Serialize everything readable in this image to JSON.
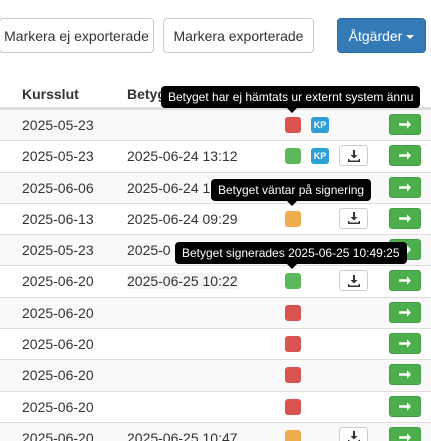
{
  "toolbar": {
    "mark_not_exported_label": "Markera ej exporterade",
    "mark_exported_label": "Markera exporterade",
    "actions_label": "Åtgärder"
  },
  "table": {
    "headers": {
      "course_end": "Kursslut",
      "grade": "Betyg"
    },
    "rows": [
      {
        "course_end": "2025-05-23",
        "grade_date": "",
        "status": "red",
        "kp": true,
        "download": false
      },
      {
        "course_end": "2025-05-23",
        "grade_date": "2025-06-24 13:12",
        "status": "green",
        "kp": true,
        "download": true
      },
      {
        "course_end": "2025-06-06",
        "grade_date": "2025-06-24 1",
        "status": "green",
        "kp": false,
        "download": false
      },
      {
        "course_end": "2025-06-13",
        "grade_date": "2025-06-24 09:29",
        "status": "orange",
        "kp": false,
        "download": true
      },
      {
        "course_end": "2025-05-23",
        "grade_date": "2025-0",
        "status": "green",
        "kp": false,
        "download": false
      },
      {
        "course_end": "2025-06-20",
        "grade_date": "2025-06-25 10:22",
        "status": "green",
        "kp": false,
        "download": true
      },
      {
        "course_end": "2025-06-20",
        "grade_date": "",
        "status": "red",
        "kp": false,
        "download": false
      },
      {
        "course_end": "2025-06-20",
        "grade_date": "",
        "status": "red",
        "kp": false,
        "download": false
      },
      {
        "course_end": "2025-06-20",
        "grade_date": "",
        "status": "red",
        "kp": false,
        "download": false
      },
      {
        "course_end": "2025-06-20",
        "grade_date": "",
        "status": "red",
        "kp": false,
        "download": false
      },
      {
        "course_end": "2025-06-20",
        "grade_date": "2025-06-25 10:47",
        "status": "orange",
        "kp": false,
        "download": true
      }
    ]
  },
  "kp_label": "KP",
  "tooltips": {
    "not_fetched": "Betyget har ej hämtats ur externt system ännu",
    "awaiting_signing": "Betyget väntar på signering",
    "signed": "Betyget signerades 2025-06-25 10:49:25"
  },
  "colors": {
    "status_red": "#d9534f",
    "status_green": "#5cb85c",
    "status_orange": "#f0ad4e",
    "kp_blue": "#2f9fd8",
    "action_green": "#4cae4c",
    "primary_blue": "#337ab7"
  }
}
